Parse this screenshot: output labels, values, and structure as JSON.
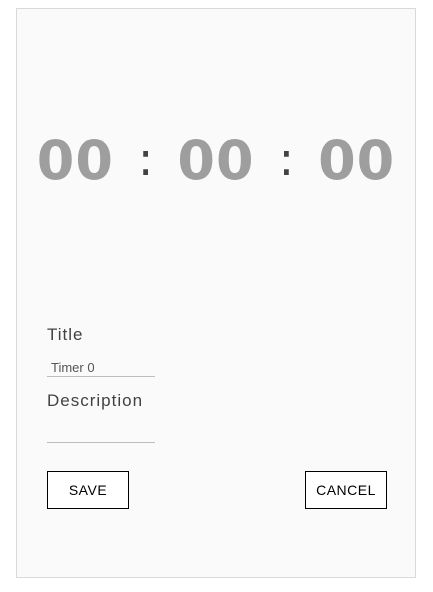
{
  "timer": {
    "hours": "00",
    "minutes": "00",
    "seconds": "00",
    "separator": ":"
  },
  "form": {
    "title_label": "Title",
    "title_value": "Timer 0",
    "description_label": "Description",
    "description_value": ""
  },
  "actions": {
    "save_label": "SAVE",
    "cancel_label": "CANCEL"
  },
  "colors": {
    "background": "#fafafa",
    "digits": "#9e9e9e",
    "separator": "#424242",
    "button_border": "#000000"
  }
}
